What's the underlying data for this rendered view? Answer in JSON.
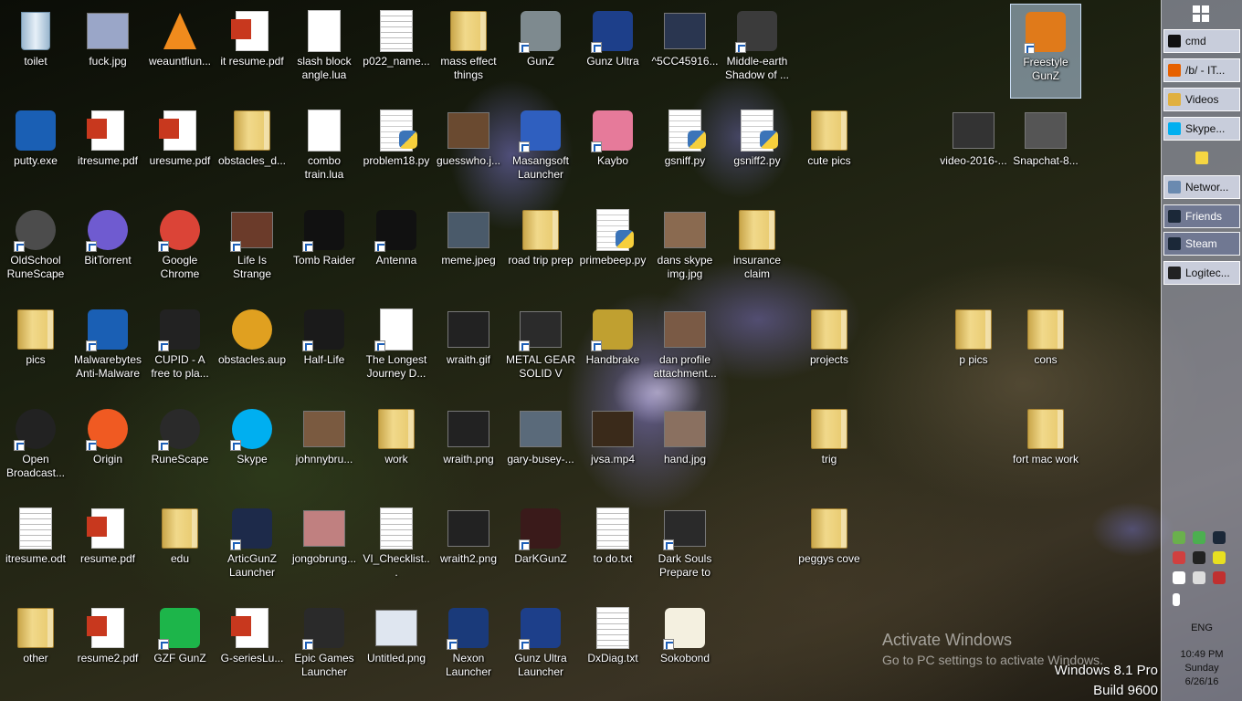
{
  "desktop": {
    "icons": [
      {
        "label": "toilet",
        "kind": "bin"
      },
      {
        "label": "fuck.jpg",
        "kind": "photo",
        "color": "#9aa6c8"
      },
      {
        "label": "weauntfiun...",
        "kind": "cone"
      },
      {
        "label": "it resume.pdf",
        "kind": "pdf"
      },
      {
        "label": "slash block angle.lua",
        "kind": "doc"
      },
      {
        "label": "p022_name...",
        "kind": "doclines"
      },
      {
        "label": "mass effect things",
        "kind": "folder"
      },
      {
        "label": "GunZ",
        "kind": "app",
        "color": "#7e8a8f",
        "shortcut": true
      },
      {
        "label": "Gunz Ultra",
        "kind": "app",
        "color": "#1d3f8a",
        "shortcut": true
      },
      {
        "label": "^5CC45916...",
        "kind": "photo",
        "color": "#2a3650"
      },
      {
        "label": "Middle-earth Shadow of ...",
        "kind": "app",
        "color": "#3b3b3b",
        "shortcut": true
      },
      {
        "label": "Freestyle GunZ",
        "kind": "app",
        "color": "#e07a1a",
        "shortcut": true,
        "selected": true
      },
      {
        "label": "putty.exe",
        "kind": "app",
        "color": "#1a5fb4"
      },
      {
        "label": "itresume.pdf",
        "kind": "pdf"
      },
      {
        "label": "uresume.pdf",
        "kind": "pdf"
      },
      {
        "label": "obstacles_d...",
        "kind": "folder"
      },
      {
        "label": "combo train.lua",
        "kind": "doc"
      },
      {
        "label": "problem18.py",
        "kind": "py"
      },
      {
        "label": "guesswho.j...",
        "kind": "photo",
        "color": "#6a4a30"
      },
      {
        "label": "Masangsoft Launcher",
        "kind": "app",
        "color": "#2f5fbf",
        "shortcut": true
      },
      {
        "label": "Kaybo",
        "kind": "app",
        "color": "#e67a9a",
        "shortcut": true
      },
      {
        "label": "gsniff.py",
        "kind": "py"
      },
      {
        "label": "gsniff2.py",
        "kind": "py"
      },
      {
        "label": "cute pics",
        "kind": "folder"
      },
      {
        "label": "video-2016-...",
        "kind": "photo",
        "color": "#333"
      },
      {
        "label": "Snapchat-8...",
        "kind": "photo",
        "color": "#555"
      },
      {
        "label": "OldSchool RuneScape",
        "kind": "circle",
        "color": "#4c4c4c",
        "shortcut": true
      },
      {
        "label": "BitTorrent",
        "kind": "circle",
        "color": "#6f5bd0",
        "shortcut": true
      },
      {
        "label": "Google Chrome",
        "kind": "circle",
        "color": "#db4437",
        "shortcut": true
      },
      {
        "label": "Life Is Strange",
        "kind": "photo",
        "color": "#6b3b2a",
        "shortcut": true
      },
      {
        "label": "Tomb Raider",
        "kind": "app",
        "color": "#111",
        "shortcut": true
      },
      {
        "label": "Antenna",
        "kind": "app",
        "color": "#111",
        "shortcut": true
      },
      {
        "label": "meme.jpeg",
        "kind": "photo",
        "color": "#4a5a6a"
      },
      {
        "label": "road trip prep",
        "kind": "folder"
      },
      {
        "label": "primebeep.py",
        "kind": "py"
      },
      {
        "label": "dans skype img.jpg",
        "kind": "photo",
        "color": "#8a6a50"
      },
      {
        "label": "insurance claim",
        "kind": "folder"
      },
      {
        "label": "pics",
        "kind": "folder"
      },
      {
        "label": "Malwarebytes Anti-Malware",
        "kind": "app",
        "color": "#1a5fb4",
        "shortcut": true
      },
      {
        "label": "CUPID - A free to pla...",
        "kind": "app",
        "color": "#222",
        "shortcut": true
      },
      {
        "label": "obstacles.aup",
        "kind": "circle",
        "color": "#e0a020"
      },
      {
        "label": "Half-Life",
        "kind": "app",
        "color": "#1a1a1a",
        "shortcut": true
      },
      {
        "label": "The Longest Journey D...",
        "kind": "doc",
        "shortcut": true
      },
      {
        "label": "wraith.gif",
        "kind": "photo",
        "color": "#222"
      },
      {
        "label": "METAL GEAR SOLID V GR...",
        "kind": "photo",
        "color": "#2b2b2b",
        "shortcut": true
      },
      {
        "label": "Handbrake",
        "kind": "app",
        "color": "#c0a030",
        "shortcut": true
      },
      {
        "label": "dan profile attachment...",
        "kind": "photo",
        "color": "#7a5a45"
      },
      {
        "label": "projects",
        "kind": "folder"
      },
      {
        "label": "p pics",
        "kind": "folder"
      },
      {
        "label": "cons",
        "kind": "folder"
      },
      {
        "label": "Open Broadcast...",
        "kind": "circle",
        "color": "#222",
        "shortcut": true
      },
      {
        "label": "Origin",
        "kind": "circle",
        "color": "#f05a22",
        "shortcut": true
      },
      {
        "label": "RuneScape",
        "kind": "circle",
        "color": "#2a2a2a",
        "shortcut": true
      },
      {
        "label": "Skype",
        "kind": "circle",
        "color": "#00aff0",
        "shortcut": true
      },
      {
        "label": "johnnybru...",
        "kind": "photo",
        "color": "#7a5a40"
      },
      {
        "label": "work",
        "kind": "folder"
      },
      {
        "label": "wraith.png",
        "kind": "photo",
        "color": "#222"
      },
      {
        "label": "gary-busey-...",
        "kind": "photo",
        "color": "#5a6a7a"
      },
      {
        "label": "jvsa.mp4",
        "kind": "photo",
        "color": "#3a2a1a"
      },
      {
        "label": "hand.jpg",
        "kind": "photo",
        "color": "#8a7060"
      },
      {
        "label": "trig",
        "kind": "folder"
      },
      {
        "label": "fort mac work",
        "kind": "folder"
      },
      {
        "label": "itresume.odt",
        "kind": "doclines"
      },
      {
        "label": "resume.pdf",
        "kind": "pdf"
      },
      {
        "label": "edu",
        "kind": "folder"
      },
      {
        "label": "ArticGunZ Launcher",
        "kind": "app",
        "color": "#1d2a4a",
        "shortcut": true
      },
      {
        "label": "jongobrung...",
        "kind": "photo",
        "color": "#c08080"
      },
      {
        "label": "VI_Checklist...",
        "kind": "doclines"
      },
      {
        "label": "wraith2.png",
        "kind": "photo",
        "color": "#222"
      },
      {
        "label": "DarKGunZ",
        "kind": "app",
        "color": "#3a1a1a",
        "shortcut": true
      },
      {
        "label": "to do.txt",
        "kind": "doclines"
      },
      {
        "label": "Dark Souls Prepare to D...",
        "kind": "photo",
        "color": "#2a2a2a",
        "shortcut": true
      },
      {
        "label": "peggys cove",
        "kind": "folder"
      },
      {
        "label": "other",
        "kind": "folder"
      },
      {
        "label": "resume2.pdf",
        "kind": "pdf"
      },
      {
        "label": "GZF GunZ",
        "kind": "app",
        "color": "#1db54a",
        "shortcut": true
      },
      {
        "label": "G-seriesLu...",
        "kind": "pdf"
      },
      {
        "label": "Epic Games Launcher",
        "kind": "app",
        "color": "#2a2a2a",
        "shortcut": true
      },
      {
        "label": "Untitled.png",
        "kind": "photo",
        "color": "#dfe6f0"
      },
      {
        "label": "Nexon Launcher",
        "kind": "app",
        "color": "#1a3a7a",
        "shortcut": true
      },
      {
        "label": "Gunz Ultra Launcher",
        "kind": "app",
        "color": "#1d3f8a",
        "shortcut": true
      },
      {
        "label": "DxDiag.txt",
        "kind": "doclines"
      },
      {
        "label": "Sokobond",
        "kind": "app",
        "color": "#f4f0e0",
        "shortcut": true
      }
    ]
  },
  "taskbar": {
    "buttons": [
      {
        "label": "cmd",
        "color": "#111"
      },
      {
        "label": "/b/ - IT...",
        "color": "#e66000"
      },
      {
        "label": "Videos",
        "color": "#e0b040"
      },
      {
        "label": "Skype...",
        "color": "#00aff0"
      },
      {
        "label": "",
        "color": "#f5d642"
      },
      {
        "label": "Networ...",
        "color": "#6a8ab0"
      },
      {
        "label": "Friends",
        "color": "#1b2838"
      },
      {
        "label": "Steam",
        "color": "#1b2838"
      },
      {
        "label": "Logitec...",
        "color": "#222"
      }
    ],
    "language": "ENG",
    "time": "10:49 PM",
    "day": "Sunday",
    "date": "6/26/16"
  },
  "watermark": {
    "title": "Activate Windows",
    "subtitle": "Go to PC settings to activate Windows.",
    "edition": "Windows 8.1 Pro",
    "build": "Build 9600"
  }
}
